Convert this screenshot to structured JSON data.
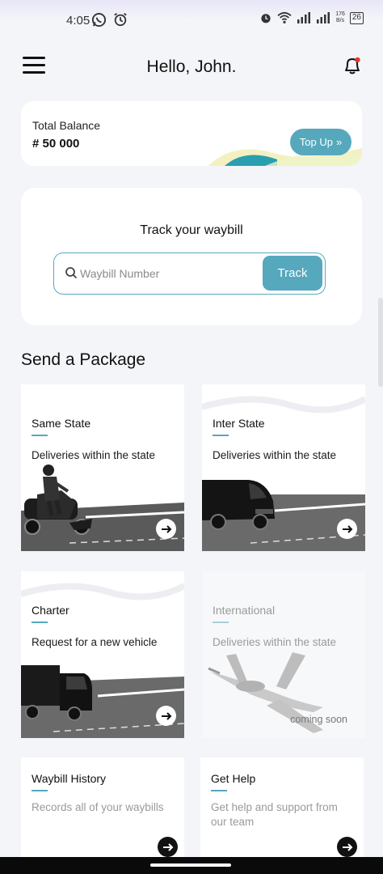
{
  "status_bar": {
    "time": "4:05",
    "net_speed_top": "176",
    "net_speed_bottom": "B/s",
    "battery": "26"
  },
  "header": {
    "greeting": "Hello, John.",
    "notification_dot_color": "#e53935"
  },
  "balance": {
    "label": "Total Balance",
    "value": "# 50 000",
    "topup_label": "Top Up"
  },
  "track": {
    "title": "Track your waybill",
    "placeholder": "Waybill Number",
    "button_label": "Track"
  },
  "send_package": {
    "title": "Send a Package",
    "cards": [
      {
        "title": "Same State",
        "desc": "Deliveries within the state",
        "icon": "motorbike-rider"
      },
      {
        "title": "Inter State",
        "desc": "Deliveries within the state",
        "icon": "van"
      },
      {
        "title": "Charter",
        "desc": "Request for a new vehicle",
        "icon": "truck"
      },
      {
        "title": "International",
        "desc": "Deliveries within the state",
        "badge": "coming soon",
        "icon": "private-jet"
      },
      {
        "title": "Waybill History",
        "desc": "Records all of your waybills"
      },
      {
        "title": "Get Help",
        "desc": "Get help and support from our team"
      }
    ]
  },
  "colors": {
    "accent": "#56a8bd",
    "background": "#f4f5f9"
  }
}
